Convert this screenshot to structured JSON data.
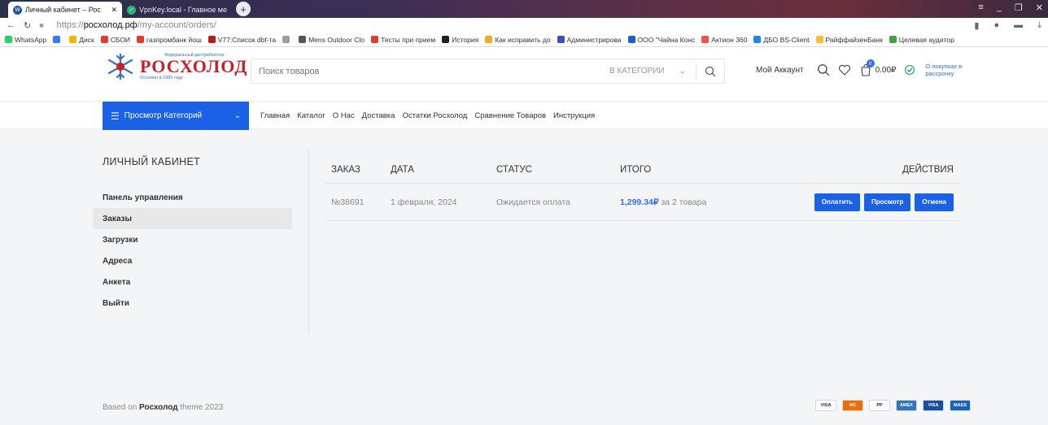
{
  "browser": {
    "tabs": [
      {
        "title": "Личный кабинет – Рос",
        "active": true
      },
      {
        "title": "VpnKey.local - Главное ме",
        "active": false
      }
    ],
    "url_prefix": "https://",
    "url_host": "росхолод.рф",
    "url_path": "/my-account/orders/",
    "bookmarks": [
      {
        "label": "WhatsApp",
        "color": "#25d366"
      },
      {
        "label": "",
        "color": "#2f80ed"
      },
      {
        "label": "Диск",
        "color": "#f4b400"
      },
      {
        "label": "СБОИ",
        "color": "#e53935"
      },
      {
        "label": "газпромбанк йош",
        "color": "#e53935"
      },
      {
        "label": "V77:Список dbf-та",
        "color": "#b71c1c"
      },
      {
        "label": "",
        "color": "#9e9e9e"
      },
      {
        "label": "Mens Outdoor Clo",
        "color": "#555555"
      },
      {
        "label": "Тесты при прием",
        "color": "#e53935"
      },
      {
        "label": "История",
        "color": "#222222"
      },
      {
        "label": "Как исправить до",
        "color": "#f9a825"
      },
      {
        "label": "Администрирова",
        "color": "#3f51b5"
      },
      {
        "label": "ООО \"Чайна Конс",
        "color": "#1565c0"
      },
      {
        "label": "Актион 360",
        "color": "#ef5350"
      },
      {
        "label": "ДБО BS-Client",
        "color": "#1e88e5"
      },
      {
        "label": "РайффайзенБанк",
        "color": "#fbc02d"
      },
      {
        "label": "Целевая аудитор",
        "color": "#43a047"
      }
    ]
  },
  "header": {
    "logo_tagline": "Федеральный дистрибьютор",
    "logo_brand": "РОСХОЛОД",
    "logo_since": "Основан в 1995 году",
    "search_placeholder": "Поиск товаров",
    "category_select": "В КАТЕГОРИИ",
    "account_label": "Мой Аккаунт",
    "cart_count": "0",
    "cart_total": "0.00₽",
    "installment": "О покупках в рассрочку"
  },
  "nav": {
    "categories_button": "Просмотр Категорий",
    "items": [
      "Главная",
      "Каталог",
      "О Нас",
      "Доставка",
      "Остатки Росхолод",
      "Сравнение Товаров",
      "Инструкция"
    ]
  },
  "sidebar": {
    "heading": "ЛИЧНЫЙ КАБИНЕТ",
    "items": [
      {
        "label": "Панель управления",
        "active": false
      },
      {
        "label": "Заказы",
        "active": true
      },
      {
        "label": "Загрузки",
        "active": false
      },
      {
        "label": "Адреса",
        "active": false
      },
      {
        "label": "Анкета",
        "active": false
      },
      {
        "label": "Выйти",
        "active": false
      }
    ]
  },
  "orders": {
    "columns": [
      "ЗАКАЗ",
      "ДАТА",
      "СТАТУС",
      "ИТОГО",
      "ДЕЙСТВИЯ"
    ],
    "rows": [
      {
        "order": "№38691",
        "date": "1 февраля, 2024",
        "status": "Ожидается оплата",
        "total_amount": "1,299.34₽",
        "total_suffix": " за 2 товара",
        "actions": [
          "Оплатить",
          "Просмотр",
          "Отмена"
        ]
      }
    ]
  },
  "footer": {
    "prefix": "Based on ",
    "brand": "Росхолод",
    "suffix": " theme 2023",
    "cards": [
      {
        "label": "VISA",
        "color": "#ffffff",
        "text": "#1a1f71"
      },
      {
        "label": "MC",
        "color": "#ef6c00",
        "text": "#ffffff"
      },
      {
        "label": "PP",
        "color": "#ffffff",
        "text": "#003087"
      },
      {
        "label": "AMEX",
        "color": "#2e77bb",
        "text": "#ffffff"
      },
      {
        "label": "VISA",
        "color": "#1a4fa0",
        "text": "#ffffff"
      },
      {
        "label": "MAES",
        "color": "#1565c0",
        "text": "#ffffff"
      }
    ]
  },
  "colors": {
    "accent": "#1a61e6",
    "brand_red": "#c8202a",
    "link_blue": "#2f6ef2"
  }
}
